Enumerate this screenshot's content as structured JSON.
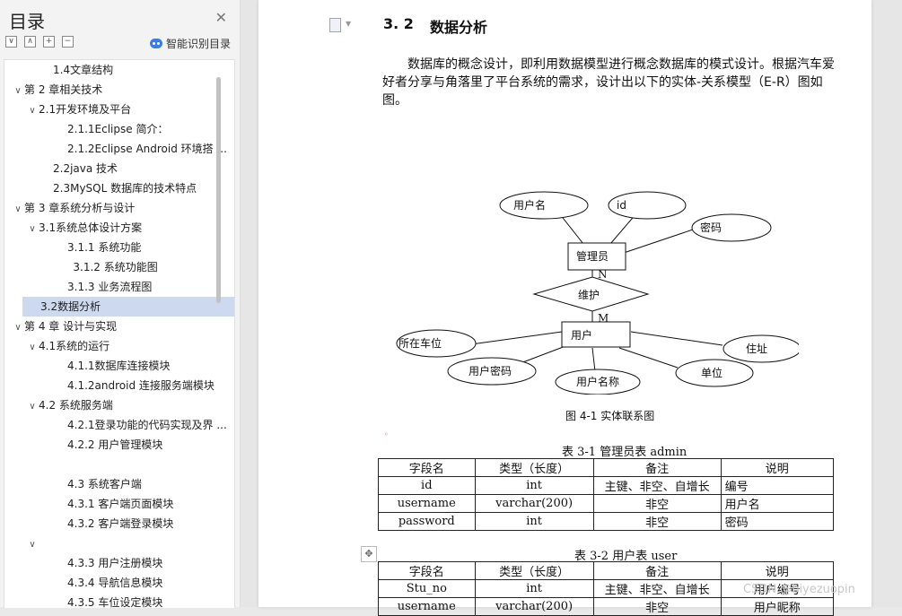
{
  "sidebar": {
    "title": "目录",
    "smart_label": "智能识别目录",
    "tools": [
      "∨",
      "∧",
      "+",
      "−"
    ],
    "toc": [
      {
        "label": "1.4文章结构",
        "indent": 2,
        "chev": ""
      },
      {
        "label": "第 2 章相关技术",
        "indent": 0,
        "chev": "∨"
      },
      {
        "label": "2.1开发环境及平台",
        "indent": 1,
        "chev": "∨"
      },
      {
        "label": "2.1.1Eclipse 简介：",
        "indent": 3,
        "chev": ""
      },
      {
        "label": "2.1.2Eclipse Android 环境搭 ...",
        "indent": 3,
        "chev": ""
      },
      {
        "label": "2.2java 技术",
        "indent": 2,
        "chev": ""
      },
      {
        "label": "2.3MySQL 数据库的技术特点",
        "indent": 2,
        "chev": ""
      },
      {
        "label": "第 3 章系统分析与设计",
        "indent": 0,
        "chev": "∨"
      },
      {
        "label": "3.1系统总体设计方案",
        "indent": 1,
        "chev": "∨"
      },
      {
        "label": "3.1.1  系统功能",
        "indent": 3,
        "chev": ""
      },
      {
        "label": "3.1.2  系统功能图",
        "indent": 3.4,
        "chev": ""
      },
      {
        "label": "3.1.3 业务流程图",
        "indent": 3,
        "chev": ""
      },
      {
        "label": "3.2数据分析",
        "indent": 2,
        "chev": "",
        "selected": true
      },
      {
        "label": "第 4 章   设计与实现",
        "indent": 0,
        "chev": "∨"
      },
      {
        "label": "4.1系统的运行",
        "indent": 1,
        "chev": "∨"
      },
      {
        "label": "4.1.1数据库连接模块",
        "indent": 3,
        "chev": ""
      },
      {
        "label": "4.1.2android 连接服务端模块",
        "indent": 3,
        "chev": ""
      },
      {
        "label": "4.2  系统服务端",
        "indent": 1,
        "chev": "∨"
      },
      {
        "label": "4.2.1登录功能的代码实现及界 ...",
        "indent": 3,
        "chev": ""
      },
      {
        "label": "4.2.2  用户管理模块",
        "indent": 3,
        "chev": ""
      },
      {
        "label": "",
        "indent": 3,
        "chev": ""
      },
      {
        "label": "4.3  系统客户端",
        "indent": 3,
        "chev": ""
      },
      {
        "label": "4.3.1 客户端页面模块",
        "indent": 3,
        "chev": ""
      },
      {
        "label": "4.3.2 客户端登录模块",
        "indent": 3,
        "chev": ""
      },
      {
        "label": "",
        "indent": 1,
        "chev": "∨"
      },
      {
        "label": "4.3.3 用户注册模块",
        "indent": 3,
        "chev": ""
      },
      {
        "label": "4.3.4 导航信息模块",
        "indent": 3,
        "chev": ""
      },
      {
        "label": "4.3.5 车位设定模块",
        "indent": 3,
        "chev": ""
      }
    ]
  },
  "doc": {
    "heading_num": "3. 2",
    "heading_title": "数据分析",
    "paragraph": "数据库的概念设计，即利用数据模型进行概念数据库的模式设计。根据汽车爱好者分享与角落里了平台系统的需求，设计出以下的实体-关系模型（E-R）图如图。",
    "er": {
      "entity_admin": "管理员",
      "entity_user": "用户",
      "relation": "维护",
      "card_n": "N",
      "card_m": "M",
      "attr_username": "用户名",
      "attr_id": "id",
      "attr_password": "密码",
      "attr_parking": "所在车位",
      "attr_user_pwd": "用户密码",
      "attr_user_name": "用户名称",
      "attr_unit": "单位",
      "attr_address": "住址"
    },
    "figure_caption": "图 4-1  实体联系图",
    "table1": {
      "caption": "表 3-1 管理员表 admin",
      "headers": [
        "字段名",
        "类型（长度）",
        "备注",
        "说明"
      ],
      "rows": [
        [
          "id",
          "int",
          "主键、非空、自增长",
          "编号"
        ],
        [
          "username",
          "varchar(200)",
          "非空",
          "用户名"
        ],
        [
          "password",
          "int",
          "非空",
          "密码"
        ]
      ]
    },
    "table2": {
      "caption": "表 3-2 用户表 user",
      "headers": [
        "字段名",
        "类型（长度）",
        "备注",
        "说明"
      ],
      "rows": [
        [
          "Stu_no",
          "int",
          "主键、非空、自增长",
          "用户编号"
        ],
        [
          "username",
          "varchar(200)",
          "非空",
          "用户昵称"
        ]
      ]
    },
    "watermark": "CSDN @biyezuopin"
  }
}
